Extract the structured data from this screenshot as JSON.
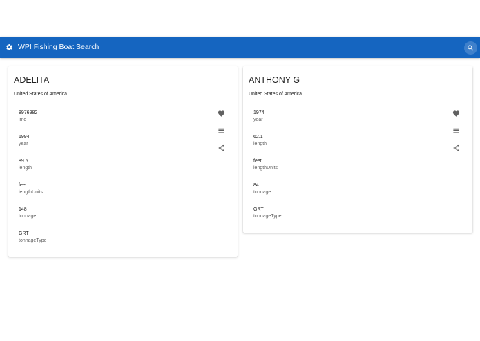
{
  "app": {
    "title": "WPI Fishing Boat Search",
    "bar_color": "#1565c0",
    "icons": {
      "settings": "gear-icon",
      "search": "search-icon"
    }
  },
  "cards": [
    {
      "name": "ADELITA",
      "country": "United States of America",
      "fields": [
        {
          "value": "8976982",
          "label": "imo"
        },
        {
          "value": "1994",
          "label": "year"
        },
        {
          "value": "89.5",
          "label": "length"
        },
        {
          "value": "feet",
          "label": "lengthUnits"
        },
        {
          "value": "148",
          "label": "tonnage"
        },
        {
          "value": "GRT",
          "label": "tonnageType"
        }
      ],
      "actions": [
        "heart-icon",
        "menu-icon",
        "share-icon"
      ]
    },
    {
      "name": "ANTHONY G",
      "country": "United States of America",
      "fields": [
        {
          "value": "1974",
          "label": "year"
        },
        {
          "value": "62.1",
          "label": "length"
        },
        {
          "value": "feet",
          "label": "lengthUnits"
        },
        {
          "value": "84",
          "label": "tonnage"
        },
        {
          "value": "GRT",
          "label": "tonnageType"
        }
      ],
      "actions": [
        "heart-icon",
        "menu-icon",
        "share-icon"
      ]
    }
  ]
}
